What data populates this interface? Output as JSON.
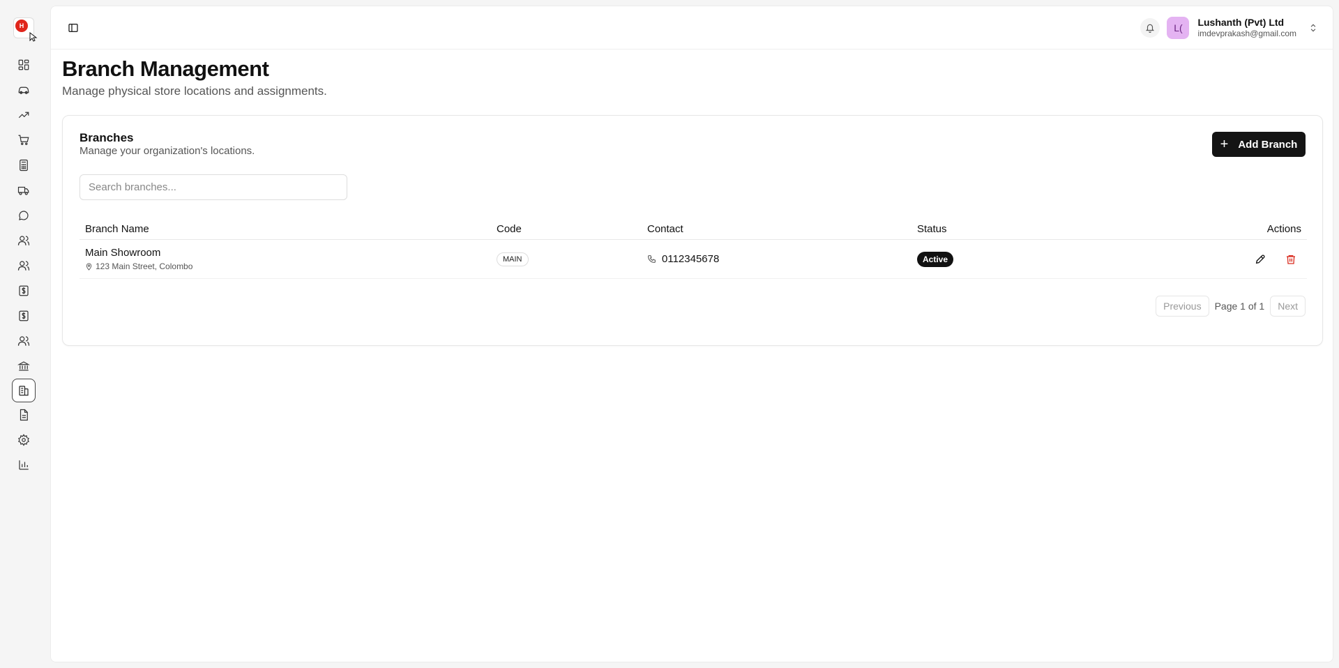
{
  "app": {
    "logo_text": "H"
  },
  "sidebar": {
    "items": [
      {
        "icon": "dashboard-icon"
      },
      {
        "icon": "car-icon"
      },
      {
        "icon": "trending-up-icon"
      },
      {
        "icon": "cart-icon"
      },
      {
        "icon": "calculator-icon"
      },
      {
        "icon": "truck-icon"
      },
      {
        "icon": "chat-icon"
      },
      {
        "icon": "users-icon"
      },
      {
        "icon": "users-icon"
      },
      {
        "icon": "dollar-icon"
      },
      {
        "icon": "dollar-icon"
      },
      {
        "icon": "users-icon"
      },
      {
        "icon": "bank-icon"
      },
      {
        "icon": "building-icon",
        "active": true
      },
      {
        "icon": "document-icon"
      },
      {
        "icon": "settings-icon"
      },
      {
        "icon": "bar-chart-icon"
      }
    ]
  },
  "header": {
    "user_initials": "L(",
    "user_name": "Lushanth (Pvt) Ltd",
    "user_email": "imdevprakash@gmail.com"
  },
  "page": {
    "title": "Branch Management",
    "subtitle": "Manage physical store locations and assignments."
  },
  "card": {
    "title": "Branches",
    "subtitle": "Manage your organization's locations.",
    "add_button": "Add Branch",
    "search_placeholder": "Search branches..."
  },
  "table": {
    "columns": [
      "Branch Name",
      "Code",
      "Contact",
      "Status",
      "Actions"
    ],
    "rows": [
      {
        "name": "Main Showroom",
        "address": "123 Main Street, Colombo",
        "code": "MAIN",
        "contact": "0112345678",
        "status": "Active"
      }
    ]
  },
  "pagination": {
    "previous": "Previous",
    "info": "Page 1 of 1",
    "next": "Next"
  },
  "colors": {
    "accent": "#141414",
    "logo_red": "#e0251b",
    "delete_red": "#d92d20",
    "avatar_bg": "#e4b3f2"
  }
}
